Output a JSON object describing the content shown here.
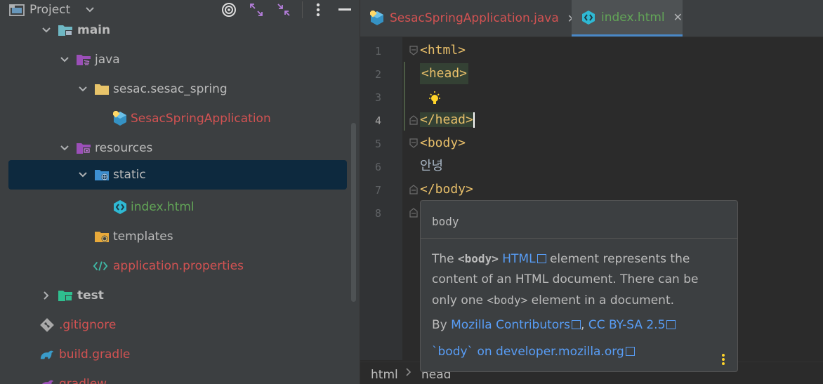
{
  "project_panel": {
    "title": "Project",
    "tree": [
      {
        "label": "main",
        "style": "bold",
        "icon": "source-root-folder-icon",
        "expanded": true
      },
      {
        "label": "java",
        "style": "normal",
        "icon": "java-source-folder-icon",
        "expanded": true
      },
      {
        "label": "sesac.sesac_spring",
        "style": "normal",
        "icon": "package-folder-icon",
        "expanded": true
      },
      {
        "label": "SesacSpringApplication",
        "style": "red",
        "icon": "spring-class-icon"
      },
      {
        "label": "resources",
        "style": "normal",
        "icon": "resources-folder-icon",
        "expanded": true
      },
      {
        "label": "static",
        "style": "normal",
        "icon": "web-folder-icon",
        "expanded": true,
        "selected": true
      },
      {
        "label": "index.html",
        "style": "green",
        "icon": "html-file-icon"
      },
      {
        "label": "templates",
        "style": "normal",
        "icon": "templates-folder-icon"
      },
      {
        "label": "application.properties",
        "style": "red",
        "icon": "properties-file-icon"
      },
      {
        "label": "test",
        "style": "bold",
        "icon": "test-folder-icon",
        "expanded": false
      },
      {
        "label": ".gitignore",
        "style": "red",
        "icon": "git-icon"
      },
      {
        "label": "build.gradle",
        "style": "red",
        "icon": "gradle-icon"
      },
      {
        "label": "gradlew",
        "style": "red",
        "icon": "gradle-icon"
      }
    ]
  },
  "editor": {
    "tabs": [
      {
        "label": "SesacSpringApplication.java",
        "color": "#d25252",
        "icon": "spring-class-icon",
        "active": false
      },
      {
        "label": "index.html",
        "color": "#62a557",
        "icon": "html-file-icon",
        "active": true
      }
    ],
    "close_glyph": "✕",
    "line_numbers": [
      "1",
      "2",
      "3",
      "4",
      "5",
      "6",
      "7",
      "8"
    ],
    "current_line": "4",
    "code": {
      "line1": "<html>",
      "line2": "<head>",
      "line4": "</head>",
      "line5": "<body>",
      "line6": "안녕",
      "line7": "</body>"
    },
    "breadcrumb": [
      "html",
      "head"
    ]
  },
  "doc_popup": {
    "title": "body",
    "body_prefix": "The ",
    "body_tag": "<body>",
    "body_link": "HTML",
    "body_rest_1": " element represents the content of an HTML document. There can be only one ",
    "body_code": "<body>",
    "body_rest_2": " element in a document.",
    "by_label": "By ",
    "by_link": "Mozilla Contributors",
    "license_sep": ", ",
    "license_link": "CC BY-SA 2.5",
    "source_link": "`body` on developer.mozilla.org"
  },
  "colors": {
    "accent": "#4a88c7",
    "link": "#589df6",
    "tag": "#e8bf6a",
    "error_file": "#d25252",
    "new_file": "#62a557"
  }
}
